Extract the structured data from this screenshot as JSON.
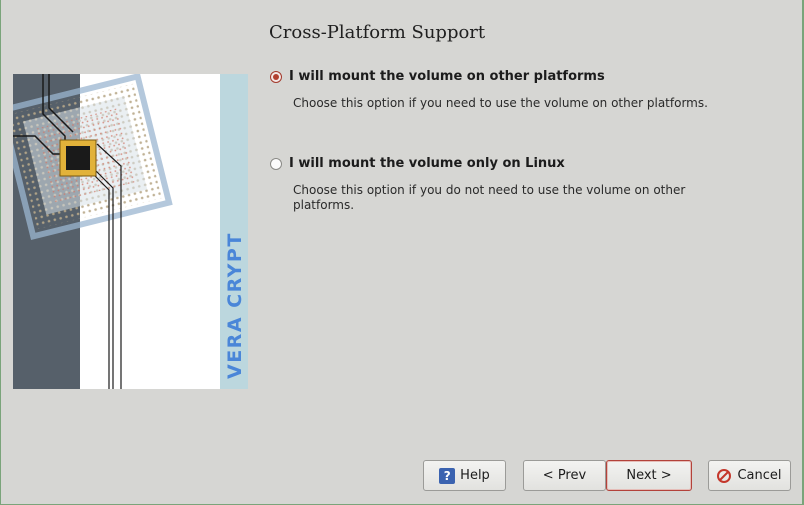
{
  "page": {
    "title": "Cross-Platform Support"
  },
  "side_image": {
    "brand_text": "VERA CRYPT"
  },
  "options": [
    {
      "label": "I will mount the volume on other platforms",
      "description": "Choose this option if you need to use the volume on other platforms.",
      "selected": true
    },
    {
      "label": "I will mount the volume only on Linux",
      "description": "Choose this option if you do not need to use the volume on other platforms.",
      "selected": false
    }
  ],
  "buttons": {
    "help": "Help",
    "prev": "< Prev",
    "next": "Next >",
    "cancel": "Cancel"
  },
  "colors": {
    "accent": "#b24030",
    "brand_blue": "#4a86d8"
  }
}
